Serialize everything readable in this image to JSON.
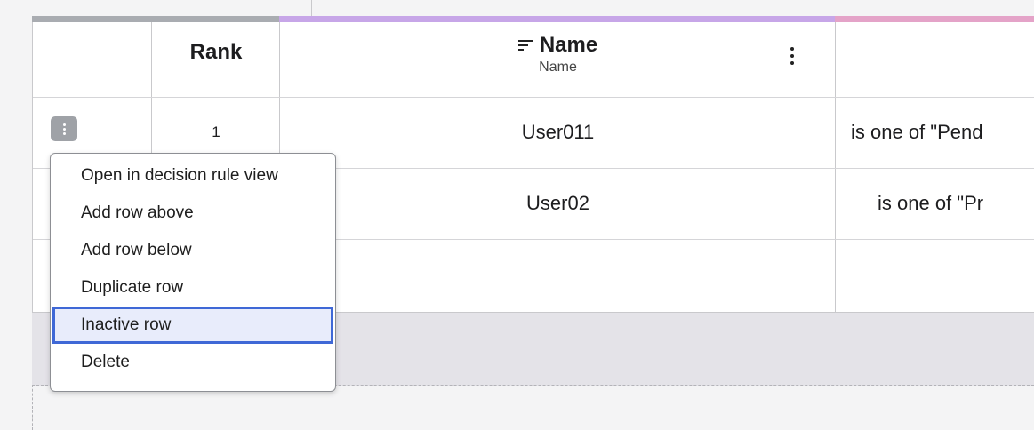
{
  "table": {
    "header": {
      "rank_label": "Rank",
      "name_label": "Name",
      "name_sublabel": "Name",
      "name_sort_icon": "sort-lines-icon",
      "name_menu_icon": "kebab-menu-icon"
    },
    "rows": [
      {
        "rank": "1",
        "name": "User011",
        "condition": "is one of \"Pend"
      },
      {
        "rank": "",
        "name": "User02",
        "condition": "is one of \"Pr"
      },
      {
        "rank": "",
        "name": "",
        "condition": ""
      }
    ],
    "row_action_icon": "kebab-menu-icon"
  },
  "context_menu": {
    "items": [
      {
        "label": "Open in decision rule view",
        "selected": false
      },
      {
        "label": "Add row above",
        "selected": false
      },
      {
        "label": "Add row below",
        "selected": false
      },
      {
        "label": "Duplicate row",
        "selected": false
      },
      {
        "label": "Inactive row",
        "selected": true
      },
      {
        "label": "Delete",
        "selected": false
      }
    ]
  },
  "colors": {
    "header_grey_bar": "#a9acb1",
    "header_purple_bar": "#c7a6e8",
    "header_pink_bar": "#e4a3c8",
    "selection_border": "#3f68d6",
    "selection_fill": "#e8ecfb"
  }
}
